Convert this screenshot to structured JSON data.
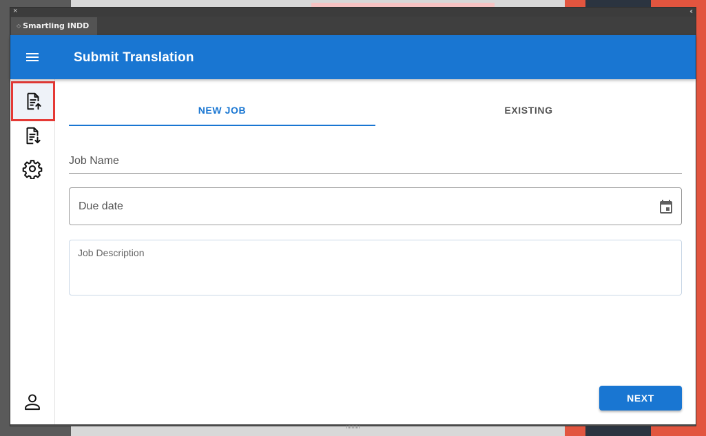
{
  "window": {
    "tab_title": "Smartling INDD",
    "close_glyph": "×",
    "collapse_glyph": "‹‹",
    "grip_glyph": "◇"
  },
  "app": {
    "title": "Submit Translation",
    "menu_icon": "menu-icon",
    "accent_color": "#1976d2"
  },
  "sidebar": {
    "items": [
      {
        "icon": "file-upload-icon",
        "active": true,
        "highlight_color": "#e53935"
      },
      {
        "icon": "file-download-icon",
        "active": false
      },
      {
        "icon": "gear-icon",
        "active": false
      },
      {
        "icon": "user-icon",
        "active": false
      }
    ]
  },
  "tabs": [
    {
      "label": "NEW JOB",
      "active": true
    },
    {
      "label": "EXISTING",
      "active": false
    }
  ],
  "form": {
    "job_name_label": "Job Name",
    "due_date_label": "Due date",
    "due_date_icon": "calendar-icon",
    "job_description_placeholder": "Job Description"
  },
  "actions": {
    "next_label": "NEXT"
  }
}
